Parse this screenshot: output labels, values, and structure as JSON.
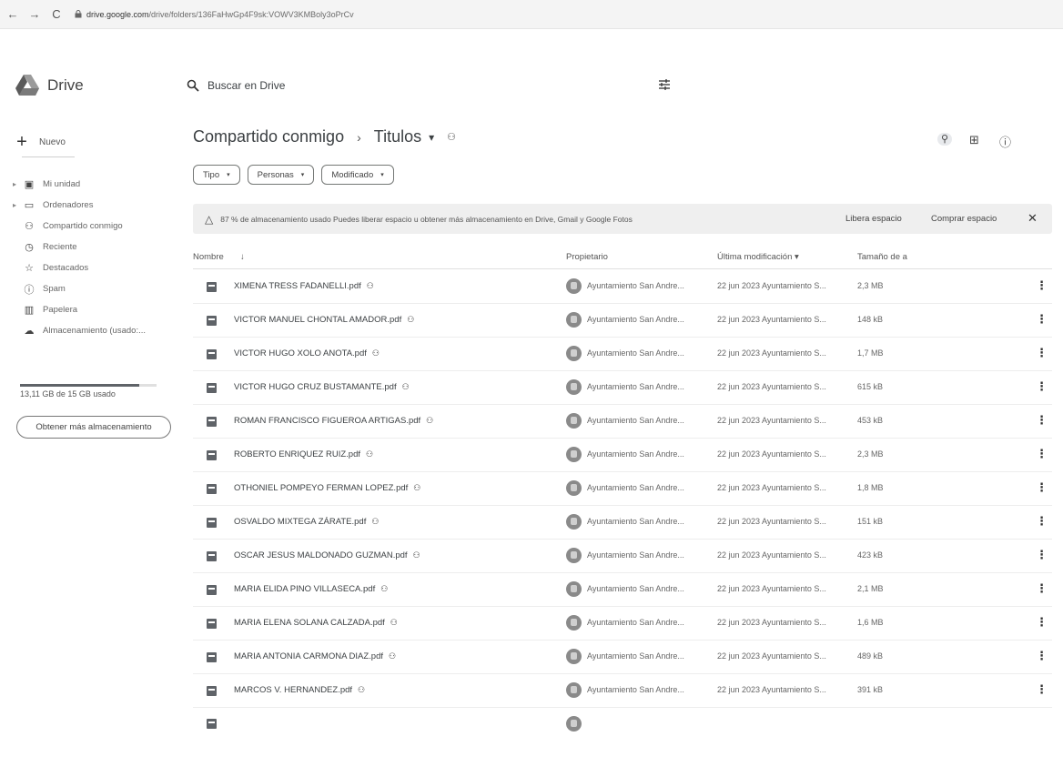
{
  "browser": {
    "back": "←",
    "forward": "→",
    "reload": "C",
    "url_host": "drive.google.com",
    "url_path": "/drive/folders/136FaHwGp4F9sk:VOWV3KMBoly3oPrCv"
  },
  "app": {
    "name": "Drive"
  },
  "search": {
    "placeholder": "Buscar en Drive"
  },
  "sidebar": {
    "new_label": "Nuevo",
    "items": [
      {
        "label": "Mi unidad",
        "icon": "my-drive-icon",
        "glyph": "▣"
      },
      {
        "label": "Ordenadores",
        "icon": "computers-icon",
        "glyph": "▭"
      },
      {
        "label": "Compartido conmigo",
        "icon": "shared-icon",
        "glyph": "⚇"
      },
      {
        "label": "Reciente",
        "icon": "clock-icon",
        "glyph": "◷"
      },
      {
        "label": "Destacados",
        "icon": "star-icon",
        "glyph": "☆"
      },
      {
        "label": "Spam",
        "icon": "spam-icon",
        "glyph": "ⓘ"
      },
      {
        "label": "Papelera",
        "icon": "trash-icon",
        "glyph": "▥"
      },
      {
        "label": "Almacenamiento (usado:...",
        "icon": "cloud-icon",
        "glyph": "☁"
      }
    ],
    "storage_used_fraction": 0.87,
    "storage_text": "13,11 GB de 15 GB usado",
    "more_storage": "Obtener más almacenamiento"
  },
  "breadcrumb": {
    "root": "Compartido conmigo",
    "sep": "›",
    "current": "Titulos",
    "caret": "▾",
    "share_glyph": "⚇"
  },
  "view": {
    "filter_glyph": "⚲",
    "grid_glyph": "⊞",
    "info_glyph": "ⓘ"
  },
  "filters": [
    {
      "label": "Tipo"
    },
    {
      "label": "Personas"
    },
    {
      "label": "Modificado"
    }
  ],
  "banner": {
    "warn_glyph": "△",
    "message": "87 % de almacenamiento usado Puedes liberar espacio u obtener más almacenamiento en Drive, Gmail y Google Fotos",
    "free_space": "Libera espacio",
    "buy_space": "Comprar espacio",
    "close": "✕"
  },
  "table": {
    "headers": {
      "name": "Nombre",
      "sort_arrow": "↓",
      "owner": "Propietario",
      "modified": "Última modificación ▾",
      "size": "Tamaño de a"
    },
    "rows": [
      {
        "name": "XIMENA TRESS FADANELLI.pdf",
        "owner": "Ayuntamiento San Andre...",
        "modified": "22 jun 2023 Ayuntamiento S...",
        "size": "2,3 MB"
      },
      {
        "name": "VICTOR MANUEL CHONTAL AMADOR.pdf",
        "owner": "Ayuntamiento San Andre...",
        "modified": "22 jun 2023 Ayuntamiento S...",
        "size": "148 kB"
      },
      {
        "name": "VICTOR HUGO XOLO ANOTA.pdf",
        "owner": "Ayuntamiento San Andre...",
        "modified": "22 jun 2023 Ayuntamiento S...",
        "size": "1,7 MB"
      },
      {
        "name": "VICTOR HUGO CRUZ BUSTAMANTE.pdf",
        "owner": "Ayuntamiento San Andre...",
        "modified": "22 jun 2023 Ayuntamiento S...",
        "size": "615 kB"
      },
      {
        "name": "ROMAN FRANCISCO FIGUEROA ARTIGAS.pdf",
        "owner": "Ayuntamiento San Andre...",
        "modified": "22 jun 2023 Ayuntamiento S...",
        "size": "453 kB"
      },
      {
        "name": "ROBERTO ENRIQUEZ RUIZ.pdf",
        "owner": "Ayuntamiento San Andre...",
        "modified": "22 jun 2023 Ayuntamiento S...",
        "size": "2,3 MB"
      },
      {
        "name": "OTHONIEL POMPEYO FERMAN LOPEZ.pdf",
        "owner": "Ayuntamiento San Andre...",
        "modified": "22 jun 2023 Ayuntamiento S...",
        "size": "1,8 MB"
      },
      {
        "name": "OSVALDO MIXTEGA ZÁRATE.pdf",
        "owner": "Ayuntamiento San Andre...",
        "modified": "22 jun 2023 Ayuntamiento S...",
        "size": "151 kB"
      },
      {
        "name": "OSCAR JESUS MALDONADO GUZMAN.pdf",
        "owner": "Ayuntamiento San Andre...",
        "modified": "22 jun 2023 Ayuntamiento S...",
        "size": "423 kB"
      },
      {
        "name": "MARIA ELIDA PINO VILLASECA.pdf",
        "owner": "Ayuntamiento San Andre...",
        "modified": "22 jun 2023 Ayuntamiento S...",
        "size": "2,1 MB"
      },
      {
        "name": "MARIA ELENA SOLANA CALZADA.pdf",
        "owner": "Ayuntamiento San Andre...",
        "modified": "22 jun 2023 Ayuntamiento S...",
        "size": "1,6 MB"
      },
      {
        "name": "MARIA ANTONIA CARMONA DIAZ.pdf",
        "owner": "Ayuntamiento San Andre...",
        "modified": "22 jun 2023 Ayuntamiento S...",
        "size": "489 kB"
      },
      {
        "name": "MARCOS V. HERNANDEZ.pdf",
        "owner": "Ayuntamiento San Andre...",
        "modified": "22 jun 2023 Ayuntamiento S...",
        "size": "391 kB"
      }
    ],
    "shared_glyph": "⚇",
    "kebab_glyph": "⋮"
  }
}
